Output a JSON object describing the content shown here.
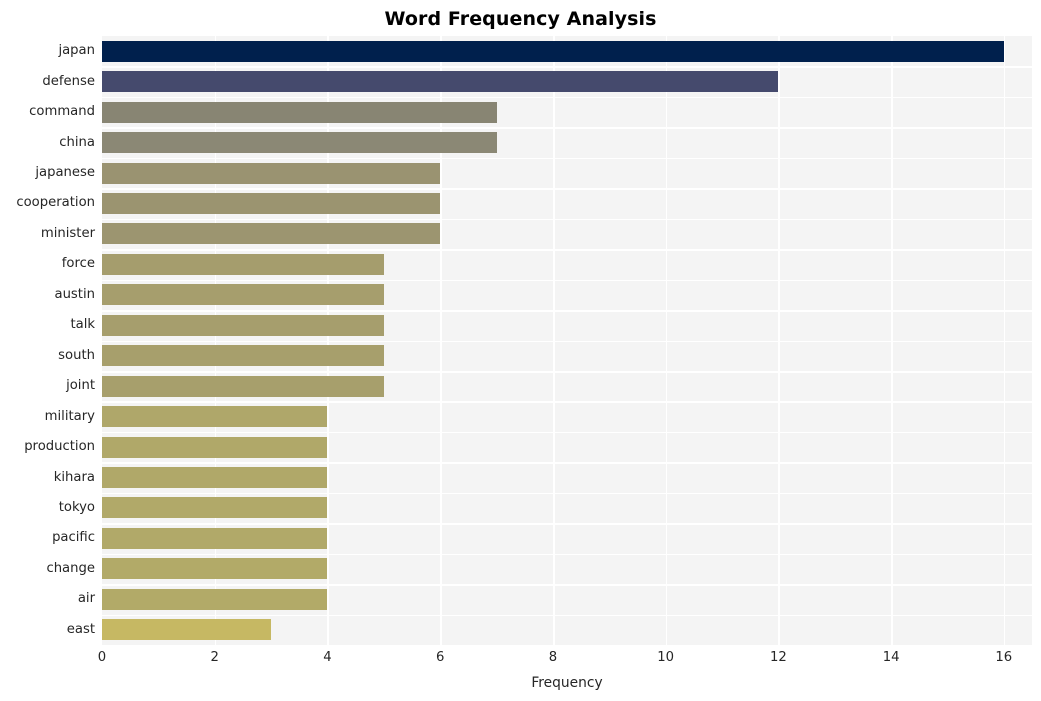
{
  "chart_data": {
    "type": "bar",
    "orientation": "horizontal",
    "title": "Word Frequency Analysis",
    "xlabel": "Frequency",
    "ylabel": "",
    "xlim": [
      0,
      16.5
    ],
    "xticks": [
      0,
      2,
      4,
      6,
      8,
      10,
      12,
      14,
      16
    ],
    "xtick_labels": [
      "0",
      "2",
      "4",
      "6",
      "8",
      "10",
      "12",
      "14",
      "16"
    ],
    "grid": "vertical-and-horizontal-white-on-light-gray",
    "legend": "none",
    "categories": [
      "japan",
      "defense",
      "command",
      "china",
      "japanese",
      "cooperation",
      "minister",
      "force",
      "austin",
      "talk",
      "south",
      "joint",
      "military",
      "production",
      "kihara",
      "tokyo",
      "pacific",
      "change",
      "air",
      "east"
    ],
    "values": [
      16,
      12,
      7,
      7,
      6,
      6,
      6,
      5,
      5,
      5,
      5,
      5,
      4,
      4,
      4,
      4,
      4,
      4,
      4,
      3
    ],
    "bar_colors": [
      "#00204d",
      "#454a6d",
      "#888573",
      "#8b8875",
      "#9a9371",
      "#9b9470",
      "#9c9570",
      "#a59d6d",
      "#a69e6d",
      "#a69e6d",
      "#a79f6c",
      "#a79f6c",
      "#afa76a",
      "#b0a869",
      "#b0a869",
      "#b1a969",
      "#b1a969",
      "#b2aa68",
      "#b2aa68",
      "#c6b863"
    ],
    "colormap": "cividis",
    "background_color": "#f4f4f4",
    "gridline_color": "#ffffff",
    "tick_label_color": "#262626",
    "title_color": "#000000",
    "n_bars": 20
  }
}
